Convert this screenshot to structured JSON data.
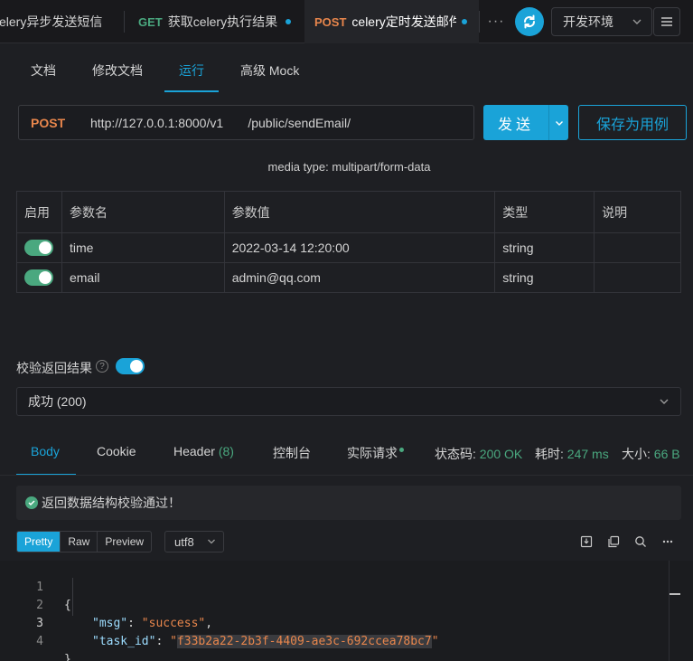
{
  "tabs": [
    {
      "method": "",
      "title": "celery异步发送短信"
    },
    {
      "method": "GET",
      "title": "获取celery执行结果"
    },
    {
      "method": "POST",
      "title": "celery定时发送邮件"
    }
  ],
  "toolbar": {
    "more_label": "···",
    "environment": "开发环境"
  },
  "subtabs": [
    "文档",
    "修改文档",
    "运行",
    "高级 Mock"
  ],
  "request": {
    "method": "POST",
    "url": "http://127.0.0.1:8000/v1       /public/sendEmail/",
    "send_label": "发送",
    "save_label": "保存为用例",
    "media_type": "media type: multipart/form-data"
  },
  "params": {
    "headers": [
      "启用",
      "参数名",
      "参数值",
      "类型",
      "说明"
    ],
    "rows": [
      {
        "enabled": true,
        "name": "time",
        "value": "2022-03-14 12:20:00",
        "type": "string",
        "desc": ""
      },
      {
        "enabled": true,
        "name": "email",
        "value": "admin@qq.com",
        "type": "string",
        "desc": ""
      }
    ]
  },
  "validation": {
    "label": "校验返回结果",
    "help": "?",
    "enabled": true,
    "status_option": "成功 (200)"
  },
  "response_tabs": {
    "body": "Body",
    "cookie": "Cookie",
    "header": "Header",
    "header_count": "(8)",
    "console": "控制台",
    "actual_request": "实际请求"
  },
  "stats": {
    "status_label": "状态码:",
    "status_value": "200 OK",
    "time_label": "耗时:",
    "time_value": "247 ms",
    "size_label": "大小:",
    "size_value": "66 B"
  },
  "banner": {
    "text": "返回数据结构校验通过！"
  },
  "format": {
    "modes": [
      "Pretty",
      "Raw",
      "Preview"
    ],
    "encoding": "utf8"
  },
  "code": {
    "line_numbers": [
      "1",
      "2",
      "3",
      "4"
    ],
    "open_brace": "{",
    "close_brace": "}",
    "msg_key": "\"msg\"",
    "msg_value": "\"success\"",
    "task_key": "\"task_id\"",
    "task_value_quote": "\"",
    "task_value": "f33b2a22-2b3f-4409-ae3c-692ccea78bc7",
    "colon": ": ",
    "comma": ","
  },
  "colors": {
    "accent": "#1aa3d8",
    "success": "#4aa87f",
    "post": "#e8864c",
    "get": "#4aa87f"
  }
}
